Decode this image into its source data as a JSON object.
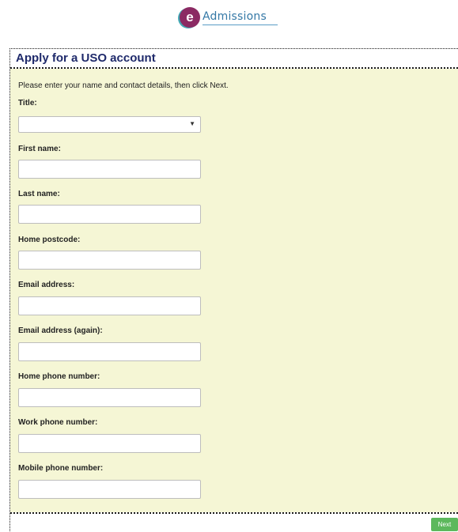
{
  "brand": {
    "letter": "e",
    "name": "Admissions"
  },
  "panel": {
    "title": "Apply for a USO account"
  },
  "form": {
    "intro": "Please enter your name and contact details, then click Next.",
    "title_label": "Title:",
    "title_value": "",
    "fields": [
      {
        "label": "First name:",
        "value": ""
      },
      {
        "label": "Last name:",
        "value": ""
      },
      {
        "label": "Home postcode:",
        "value": ""
      },
      {
        "label": "Email address:",
        "value": ""
      },
      {
        "label": "Email address (again):",
        "value": ""
      },
      {
        "label": "Home phone number:",
        "value": ""
      },
      {
        "label": "Work phone number:",
        "value": ""
      },
      {
        "label": "Mobile phone number:",
        "value": ""
      }
    ]
  },
  "footer": {
    "next_label": "Next"
  },
  "colors": {
    "body_bg": "#f5f6d5",
    "title_text": "#1f2a6b",
    "next_button": "#5cb85c",
    "logo_circle": "#8b2a63",
    "logo_text": "#3478a6"
  }
}
